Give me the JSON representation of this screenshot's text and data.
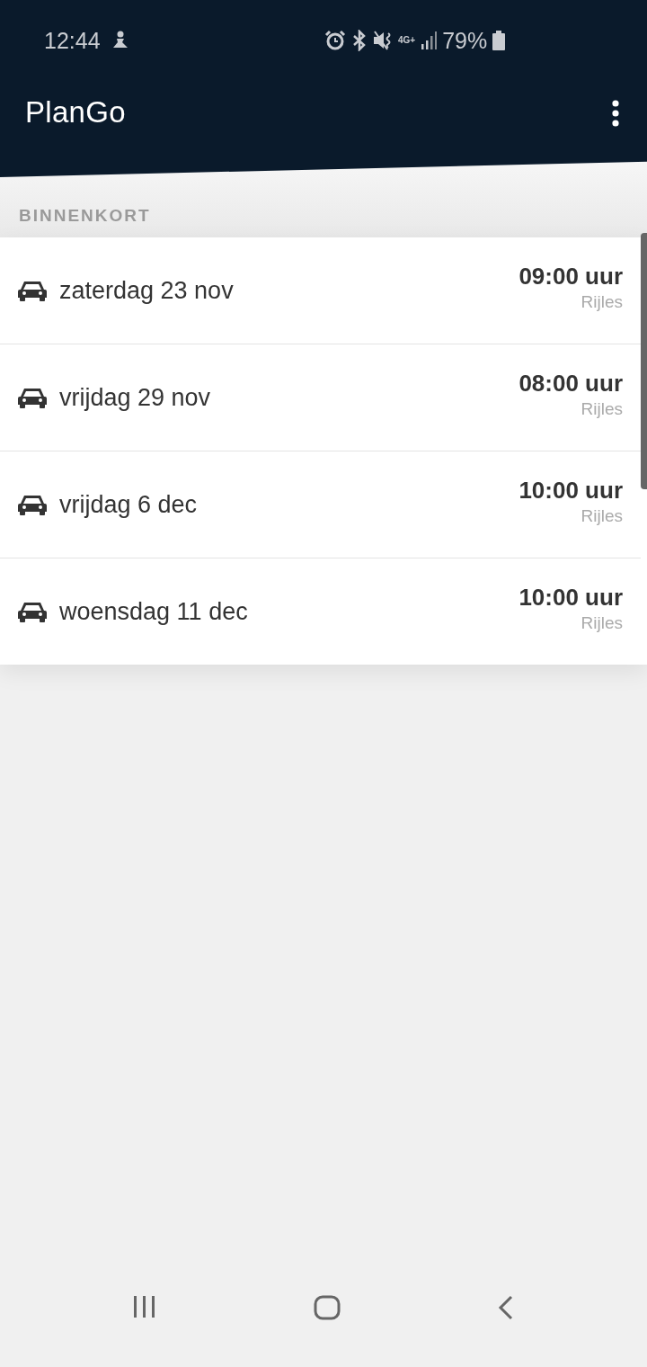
{
  "status_bar": {
    "time": "12:44",
    "network": "4G+",
    "battery": "79%"
  },
  "app_bar": {
    "title": "PlanGo"
  },
  "section": {
    "title": "BINNENKORT"
  },
  "appointments": [
    {
      "date": "zaterdag 23 nov",
      "time": "09:00 uur",
      "type": "Rijles"
    },
    {
      "date": "vrijdag 29 nov",
      "time": "08:00 uur",
      "type": "Rijles"
    },
    {
      "date": "vrijdag 6 dec",
      "time": "10:00 uur",
      "type": "Rijles"
    },
    {
      "date": "woensdag 11 dec",
      "time": "10:00 uur",
      "type": "Rijles"
    }
  ]
}
